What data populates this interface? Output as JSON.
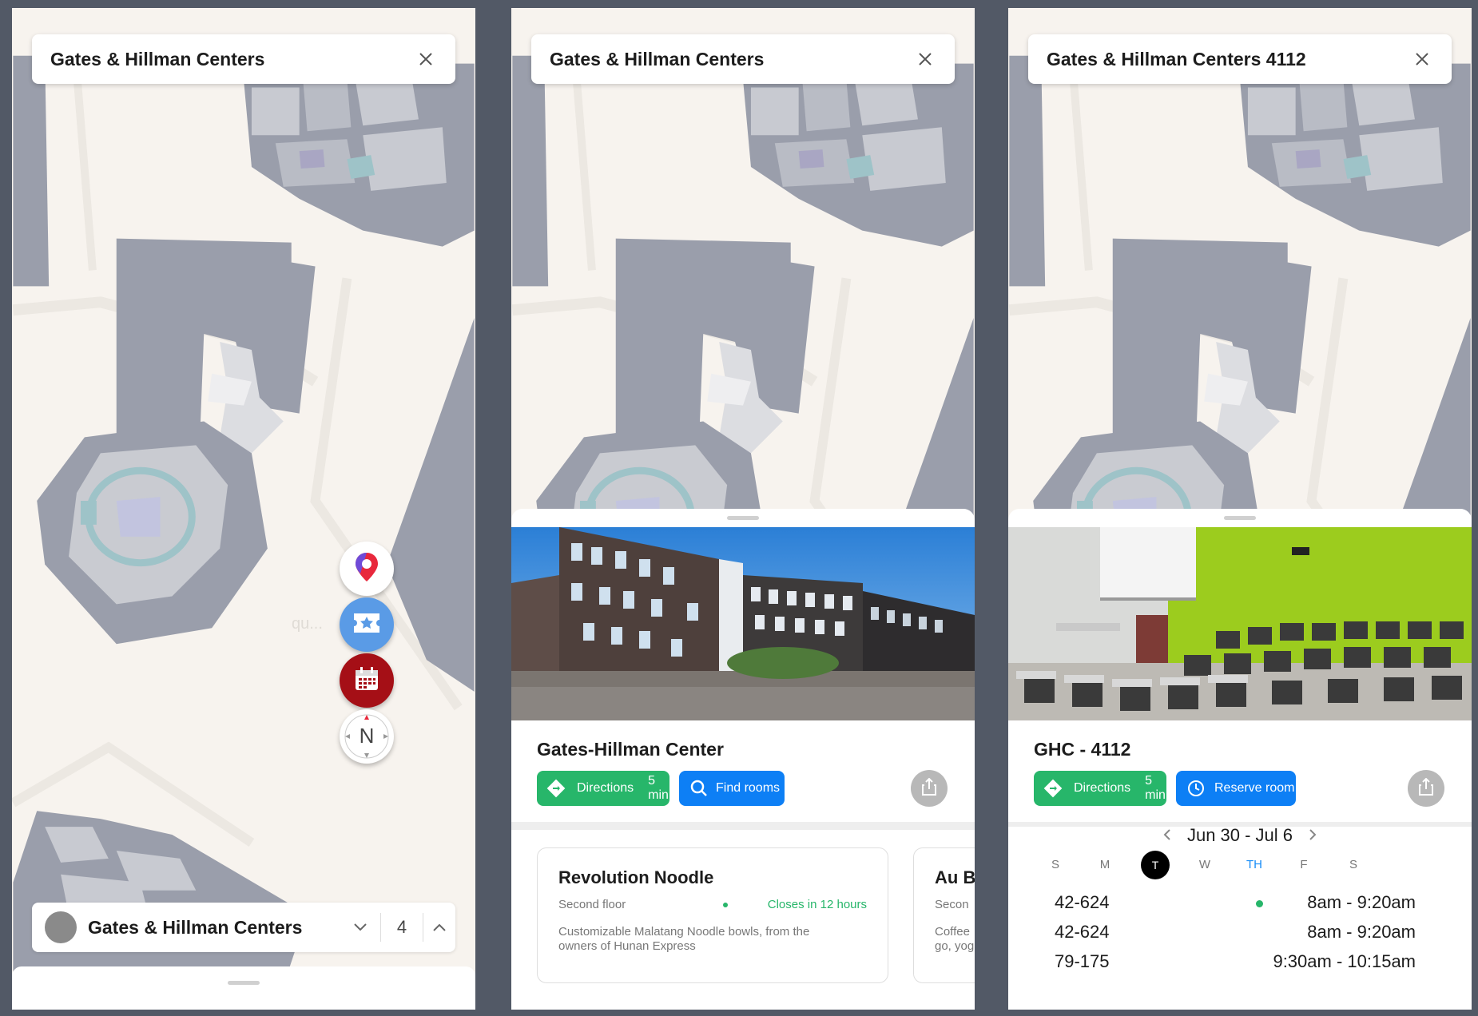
{
  "colors": {
    "bg": "#525966",
    "map_bg": "#f7f3ee",
    "building": "#9a9eab",
    "green": "#27b66a",
    "blue": "#0d7ff5"
  },
  "panel1": {
    "search": {
      "text": "Gates & Hillman Centers",
      "close_icon": "close-icon"
    },
    "fabs": [
      "location-pin-icon",
      "ticket-star-icon",
      "calendar-icon",
      "compass-icon"
    ],
    "compass_label": "N",
    "map_watermark": "qu...",
    "floor_bar": {
      "building": "Gates & Hillman Centers",
      "floor": "4"
    }
  },
  "panel2": {
    "search": {
      "text": "Gates & Hillman Centers"
    },
    "place": {
      "title": "Gates-Hillman Center",
      "directions_label": "Directions",
      "directions_time": "5 min",
      "find_rooms_label": "Find rooms"
    },
    "cards": [
      {
        "title": "Revolution Noodle",
        "floor": "Second floor",
        "status": "Closes in 12 hours",
        "desc": "Customizable Malatang Noodle bowls, from the owners of Hunan Express"
      },
      {
        "title": "Au B",
        "floor": "Secon",
        "desc": "Coffee go, yog"
      }
    ]
  },
  "panel3": {
    "search": {
      "text": "Gates & Hillman Centers 4112"
    },
    "room": {
      "title": "GHC - 4112",
      "directions_label": "Directions",
      "directions_time": "5 min",
      "reserve_label": "Reserve room"
    },
    "calendar": {
      "range": "Jun 30 - Jul 6",
      "days": [
        {
          "label": "S",
          "state": "normal"
        },
        {
          "label": "M",
          "state": "normal"
        },
        {
          "label": "T",
          "state": "today"
        },
        {
          "label": "W",
          "state": "normal"
        },
        {
          "label": "TH",
          "state": "selected"
        },
        {
          "label": "F",
          "state": "normal"
        },
        {
          "label": "S",
          "state": "normal"
        }
      ],
      "events": [
        {
          "course": "42-624",
          "time": "8am - 9:20am",
          "live": true
        },
        {
          "course": "42-624",
          "time": "8am - 9:20am",
          "live": false
        },
        {
          "course": "79-175",
          "time": "9:30am - 10:15am",
          "live": false
        }
      ]
    }
  }
}
